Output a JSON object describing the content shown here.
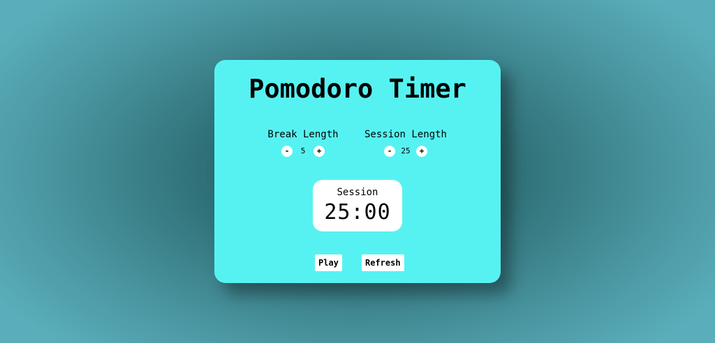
{
  "app": {
    "title": "Pomodoro Timer"
  },
  "break": {
    "label": "Break Length",
    "decrement": "-",
    "value": "5",
    "increment": "+"
  },
  "session": {
    "label": "Session Length",
    "decrement": "-",
    "value": "25",
    "increment": "+"
  },
  "timer": {
    "label": "Session",
    "time": "25:00"
  },
  "controls": {
    "play_label": "Play",
    "refresh_label": "Refresh"
  },
  "colors": {
    "card": "#56f2f2",
    "background": "#2f6f76",
    "panel": "#ffffff"
  }
}
